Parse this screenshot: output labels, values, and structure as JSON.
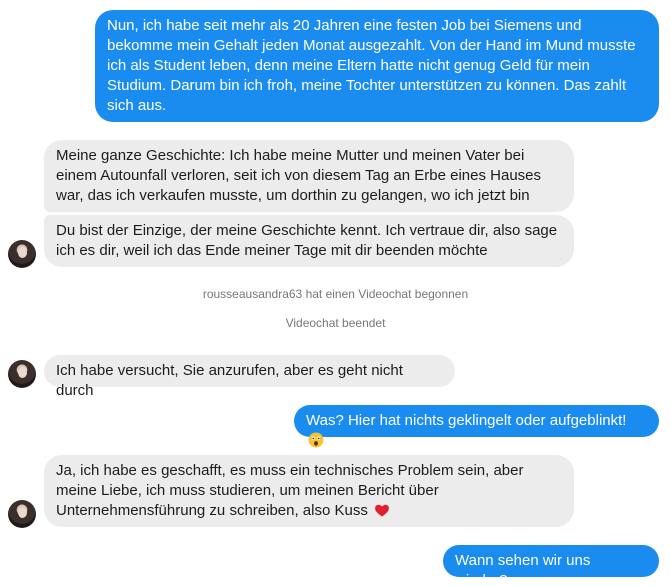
{
  "messages": [
    {
      "text": "Nun, ich habe seit mehr als 20 Jahren  eine festen Job bei Siemens und bekomme mein Gehalt jeden Monat ausgezahlt. Von der Hand im Mund musste ich als Student leben, denn meine Eltern hatte nicht genug Geld für mein Studium. Darum bin ich froh, meine Tochter unterstützen zu können. Das zahlt sich aus."
    },
    {
      "text": "Meine ganze Geschichte: Ich habe meine Mutter und meinen Vater bei einem Autounfall verloren, seit ich von diesem Tag an Erbe eines Hauses war, das ich verkaufen musste, um dorthin zu gelangen, wo ich jetzt bin"
    },
    {
      "text": "Du bist der Einzige, der meine Geschichte kennt. Ich vertraue dir, also sage ich es dir, weil ich das Ende meiner Tage mit dir beenden möchte"
    },
    {
      "text": "Ich habe versucht, Sie anzurufen, aber es geht nicht durch"
    },
    {
      "text": "Was? Hier hat nichts geklingelt oder aufgeblinkt!",
      "emoji": "astonished-face"
    },
    {
      "text": "Ja, ich habe es geschafft, es muss ein technisches Problem sein, aber meine Liebe, ich muss studieren, um meinen Bericht über Unternehmensführung zu schreiben, also Kuss",
      "emoji": "red-heart"
    },
    {
      "text": "Wann sehen wir uns wieder?"
    }
  ],
  "system": {
    "videochat_started": "rousseausandra63 hat einen Videochat begonnen",
    "videochat_ended": "Videochat beendet"
  },
  "colors": {
    "outgoing_bubble": "#1a8cf0",
    "incoming_bubble": "#ececec"
  }
}
